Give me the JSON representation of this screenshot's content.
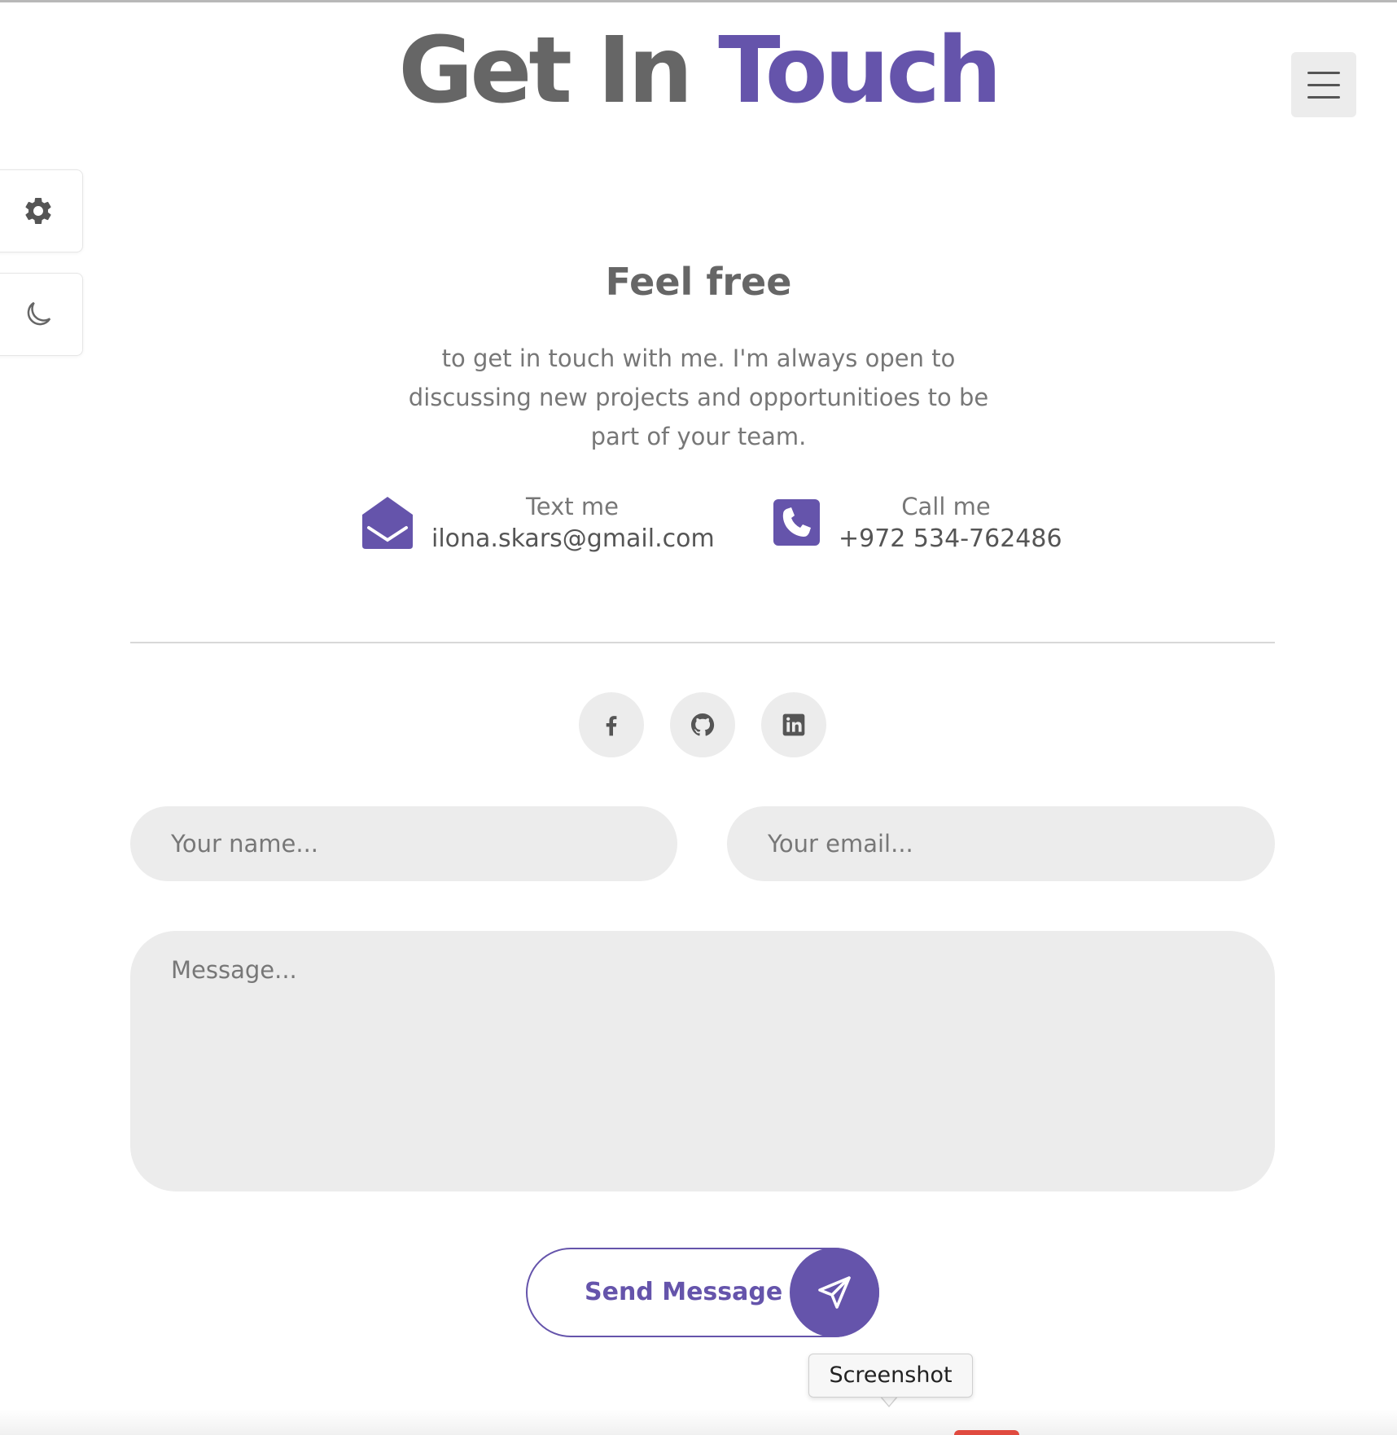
{
  "heading": {
    "part1": "Get In ",
    "part2": "Touch"
  },
  "subheading": "Feel free",
  "lead": "to get in touch with me. I'm always open to discussing new projects and opportunitioes to be part of your team.",
  "contact": {
    "email": {
      "label": "Text me",
      "value": "ilona.skars@gmail.com",
      "icon": "envelope-open-icon"
    },
    "phone": {
      "label": "Call me",
      "value": "+972 534-762486",
      "icon": "phone-square-icon"
    }
  },
  "social": [
    {
      "name": "facebook",
      "icon": "facebook-icon"
    },
    {
      "name": "github",
      "icon": "github-icon"
    },
    {
      "name": "linkedin",
      "icon": "linkedin-icon"
    }
  ],
  "form": {
    "name_placeholder": "Your name...",
    "email_placeholder": "Your email...",
    "message_placeholder": "Message...",
    "send_label": "Send Message"
  },
  "side_controls": {
    "settings_icon": "gear-icon",
    "theme_icon": "moon-icon"
  },
  "tooltip": "Screenshot",
  "colors": {
    "accent": "#6554ab",
    "text": "#666666",
    "field_bg": "#ececec"
  }
}
